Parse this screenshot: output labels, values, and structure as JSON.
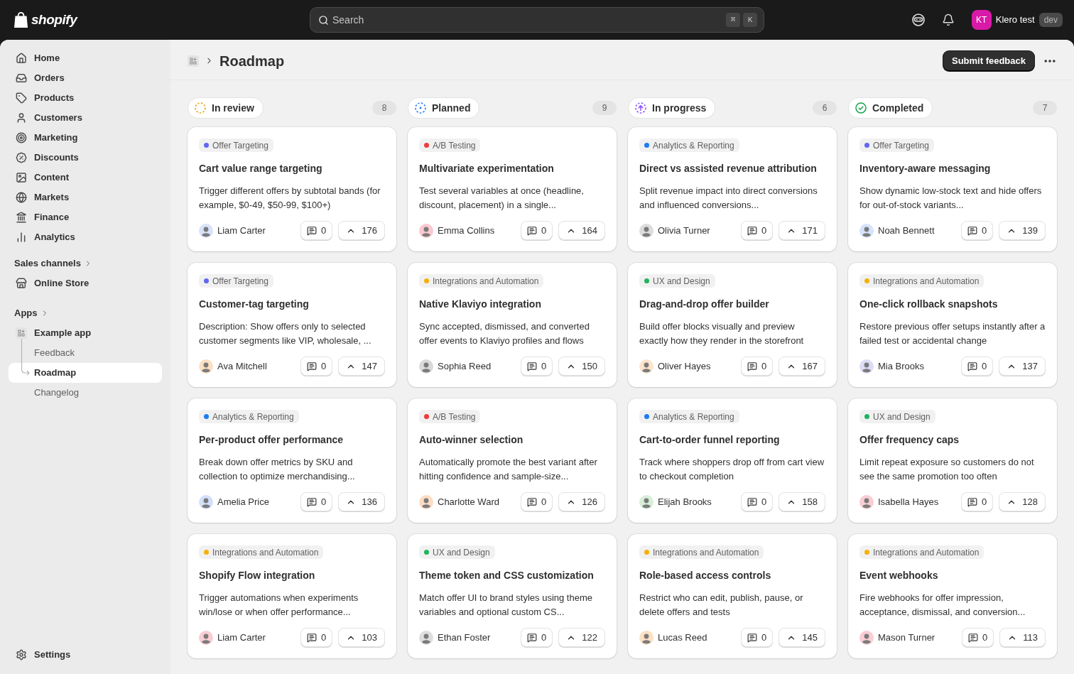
{
  "topbar": {
    "logo": "shopify",
    "search": {
      "placeholder": "Search",
      "shortcut": [
        "⌘",
        "K"
      ]
    },
    "user": {
      "initials": "KT",
      "name": "Klero test",
      "badge": "dev"
    }
  },
  "sidebar": {
    "nav": [
      {
        "label": "Home",
        "selected": false
      },
      {
        "label": "Orders",
        "selected": false
      },
      {
        "label": "Products",
        "selected": false
      },
      {
        "label": "Customers",
        "selected": false
      },
      {
        "label": "Marketing",
        "selected": false
      },
      {
        "label": "Discounts",
        "selected": false
      },
      {
        "label": "Content",
        "selected": false
      },
      {
        "label": "Markets",
        "selected": false
      },
      {
        "label": "Finance",
        "selected": false
      },
      {
        "label": "Analytics",
        "selected": false
      }
    ],
    "sections": [
      {
        "heading": "Sales channels",
        "items": [
          {
            "label": "Online Store",
            "selected": false
          }
        ]
      },
      {
        "heading": "Apps",
        "items": [
          {
            "label": "Example app",
            "selected": false,
            "children": [
              {
                "label": "Feedback",
                "selected": false
              },
              {
                "label": "Roadmap",
                "selected": true
              },
              {
                "label": "Changelog",
                "selected": false
              }
            ]
          }
        ]
      }
    ],
    "footer": [
      {
        "label": "Settings",
        "selected": false
      }
    ]
  },
  "page": {
    "title": "Roadmap",
    "primary_action": "Submit feedback"
  },
  "columns": [
    {
      "title": "In review",
      "kind": "review",
      "count": "8",
      "cards": [
        {
          "tag": {
            "label": "Offer Targeting",
            "color": "#6366f1"
          },
          "title": "Cart value range targeting",
          "description": "Trigger different offers by subtotal bands (for example, $0-49, $50-99, $100+)",
          "author": {
            "name": "Liam Carter",
            "color": "#d8e2fb"
          },
          "comments": "0",
          "votes": "176"
        },
        {
          "tag": {
            "label": "Offer Targeting",
            "color": "#6366f1"
          },
          "title": "Customer-tag targeting",
          "description": "Description: Show offers only to selected customer segments like VIP, wholesale, ...",
          "author": {
            "name": "Ava Mitchell",
            "color": "#fde0c4"
          },
          "comments": "0",
          "votes": "147"
        },
        {
          "tag": {
            "label": "Analytics & Reporting",
            "color": "#1e7bf5"
          },
          "title": "Per-product offer performance",
          "description": "Break down offer metrics by SKU and collection to optimize merchandising...",
          "author": {
            "name": "Amelia Price",
            "color": "#d3e0fb"
          },
          "comments": "0",
          "votes": "136"
        },
        {
          "tag": {
            "label": "Integrations and Automation",
            "color": "#f5b00b"
          },
          "title": "Shopify Flow integration",
          "description": "Trigger automations when experiments win/lose or when offer performance...",
          "author": {
            "name": "Liam Carter",
            "color": "#f9cdd3"
          },
          "comments": "0",
          "votes": "103"
        }
      ]
    },
    {
      "title": "Planned",
      "kind": "planned",
      "count": "9",
      "cards": [
        {
          "tag": {
            "label": "A/B Testing",
            "color": "#ef3b3b"
          },
          "title": "Multivariate experimentation",
          "description": "Test several variables at once (headline, discount, placement) in a single...",
          "author": {
            "name": "Emma Collins",
            "color": "#f9c9cf"
          },
          "comments": "0",
          "votes": "164"
        },
        {
          "tag": {
            "label": "Integrations and Automation",
            "color": "#f5b00b"
          },
          "title": "Native Klaviyo integration",
          "description": "Sync accepted, dismissed, and converted offer events to Klaviyo profiles and flows",
          "author": {
            "name": "Sophia Reed",
            "color": "#d9d9d9"
          },
          "comments": "0",
          "votes": "150"
        },
        {
          "tag": {
            "label": "A/B Testing",
            "color": "#ef3b3b"
          },
          "title": "Auto-winner selection",
          "description": "Automatically promote the best variant after hitting confidence and sample-size...",
          "author": {
            "name": "Charlotte Ward",
            "color": "#fddcc4"
          },
          "comments": "0",
          "votes": "126"
        },
        {
          "tag": {
            "label": "UX and Design",
            "color": "#22b35e"
          },
          "title": "Theme token and CSS customization",
          "description": "Match offer UI to brand styles using theme variables and optional custom CS...",
          "author": {
            "name": "Ethan Foster",
            "color": "#dedede"
          },
          "comments": "0",
          "votes": "122"
        }
      ]
    },
    {
      "title": "In progress",
      "kind": "progress",
      "count": "6",
      "cards": [
        {
          "tag": {
            "label": "Analytics & Reporting",
            "color": "#1e7bf5"
          },
          "title": "Direct vs assisted revenue attribution",
          "description": "Split revenue impact into direct conversions and influenced conversions...",
          "author": {
            "name": "Olivia Turner",
            "color": "#dcdcdc"
          },
          "comments": "0",
          "votes": "171"
        },
        {
          "tag": {
            "label": "UX and Design",
            "color": "#22b35e"
          },
          "title": "Drag-and-drop offer builder",
          "description": "Build offer blocks visually and preview exactly how they render in the storefront",
          "author": {
            "name": "Oliver Hayes",
            "color": "#fde4cc"
          },
          "comments": "0",
          "votes": "167"
        },
        {
          "tag": {
            "label": "Analytics & Reporting",
            "color": "#1e7bf5"
          },
          "title": "Cart-to-order funnel reporting",
          "description": "Track where shoppers drop off from cart view to checkout completion",
          "author": {
            "name": "Elijah Brooks",
            "color": "#d7eed9"
          },
          "comments": "0",
          "votes": "158"
        },
        {
          "tag": {
            "label": "Integrations and Automation",
            "color": "#f5b00b"
          },
          "title": "Role-based access controls",
          "description": "Restrict who can edit, publish, pause, or delete offers and tests",
          "author": {
            "name": "Lucas Reed",
            "color": "#fde0c4"
          },
          "comments": "0",
          "votes": "145"
        }
      ]
    },
    {
      "title": "Completed",
      "kind": "completed",
      "count": "7",
      "cards": [
        {
          "tag": {
            "label": "Offer Targeting",
            "color": "#6366f1"
          },
          "title": "Inventory-aware messaging",
          "description": "Show dynamic low-stock text and hide offers for out-of-stock variants...",
          "author": {
            "name": "Noah Bennett",
            "color": "#d5e3fb"
          },
          "comments": "0",
          "votes": "139"
        },
        {
          "tag": {
            "label": "Integrations and Automation",
            "color": "#f5b00b"
          },
          "title": "One-click rollback snapshots",
          "description": "Restore previous offer setups instantly after a failed test or accidental change",
          "author": {
            "name": "Mia Brooks",
            "color": "#dcdcf5"
          },
          "comments": "0",
          "votes": "137"
        },
        {
          "tag": {
            "label": "UX and Design",
            "color": "#22b35e"
          },
          "title": "Offer frequency caps",
          "description": "Limit repeat exposure so customers do not see the same promotion too often",
          "author": {
            "name": "Isabella Hayes",
            "color": "#f9cdd3"
          },
          "comments": "0",
          "votes": "128"
        },
        {
          "tag": {
            "label": "Integrations and Automation",
            "color": "#f5b00b"
          },
          "title": "Event webhooks",
          "description": "Fire webhooks for offer impression, acceptance, dismissal, and conversion...",
          "author": {
            "name": "Mason Turner",
            "color": "#f9cdd3"
          },
          "comments": "0",
          "votes": "113"
        }
      ]
    }
  ]
}
